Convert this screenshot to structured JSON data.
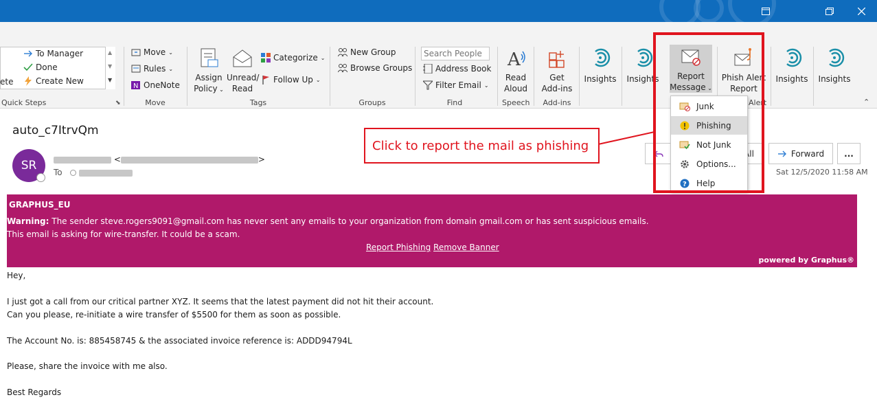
{
  "titlebar": {
    "restore_tooltip_icon": "restore-window-icon",
    "maximize_icon": "maximize-icon",
    "close_icon": "close-icon"
  },
  "ribbon": {
    "quick_steps": {
      "items": [
        "To Manager",
        "Done",
        "Create New"
      ],
      "truncated_left": "ete",
      "label": "Quick Steps"
    },
    "move": {
      "items": [
        "Move",
        "Rules",
        "OneNote"
      ],
      "label": "Move"
    },
    "tags": {
      "assign_policy": "Assign",
      "assign_policy_2": "Policy",
      "unread_read": "Unread/",
      "unread_read_2": "Read",
      "categorize": "Categorize",
      "follow_up": "Follow Up",
      "label": "Tags"
    },
    "groups": {
      "new_group": "New Group",
      "browse_groups": "Browse Groups",
      "label": "Groups"
    },
    "find": {
      "search_placeholder": "Search People",
      "address_book": "Address Book",
      "filter_email": "Filter Email",
      "label": "Find"
    },
    "speech": {
      "read_aloud": "Read",
      "read_aloud_2": "Aloud",
      "label": "Speech"
    },
    "addins": {
      "get_addins": "Get",
      "get_addins_2": "Add-ins",
      "label": "Add-ins"
    },
    "insights_1": "Insights",
    "insights_2": "Insights",
    "report_message": {
      "line1": "Report",
      "line2": "Message"
    },
    "phish_alert": {
      "line1": "Phish Alert",
      "line2": "Report",
      "group_label": "Alert"
    },
    "insights_3": "Insights",
    "insights_4": "Insights"
  },
  "dropdown": {
    "items": [
      "Junk",
      "Phishing",
      "Not Junk",
      "Options...",
      "Help"
    ],
    "selected": "Phishing"
  },
  "callout": {
    "text": "Click to report the mail as phishing"
  },
  "email": {
    "subject": "auto_c7ItrvQm",
    "avatar_initials": "SR",
    "to_label": "To",
    "actions": {
      "reply_all": "All",
      "forward": "Forward",
      "more": "..."
    },
    "date": "Sat 12/5/2020 11:58 AM"
  },
  "banner": {
    "title": "GRAPHUS_EU",
    "warning_label": "Warning:",
    "warning_text": "The sender steve.rogers9091@gmail.com has never sent any emails to your organization from domain gmail.com or has sent suspicious emails.",
    "line2": "This email is asking for wire-transfer. It could be a scam.",
    "report_phishing": "Report Phishing",
    "remove_banner": "Remove Banner",
    "powered_by": "powered by Graphus®"
  },
  "body": {
    "greeting": "Hey,",
    "p1_line1": "I just got a call from our critical partner XYZ. It seems that the latest payment did not hit their account.",
    "p1_line2": "Can you please, re-initiate a wire transfer of $5500 for them as soon as possible.",
    "p2": "The Account No. is: 885458745 & the associated invoice reference is: ADDD94794L",
    "p3": "Please, share the invoice with me also.",
    "signoff": "Best Regards"
  },
  "colors": {
    "title_bar": "#0f6cbd",
    "banner": "#b0196a",
    "callout": "#e0141e",
    "avatar": "#7a2a9a"
  }
}
